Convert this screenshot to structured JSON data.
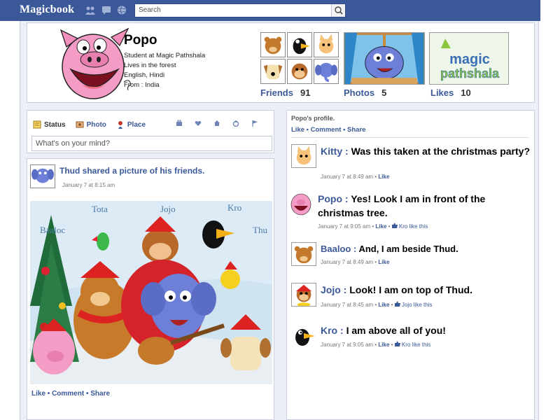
{
  "topbar": {
    "brand": "Magicbook",
    "search_placeholder": "Search"
  },
  "profile": {
    "name": "Popo",
    "info": [
      "Student at Magic Pathshala",
      "Lives in the forest",
      "English, Hindi",
      "From : India"
    ],
    "stats": {
      "friends_label": "Friends",
      "friends_count": "91",
      "photos_label": "Photos",
      "photos_count": "5",
      "likes_label": "Likes",
      "likes_count": "10"
    },
    "page_logo_line1": "magic",
    "page_logo_line2": "pathshala"
  },
  "composer": {
    "tab_status": "Status",
    "tab_photo": "Photo",
    "tab_place": "Place",
    "placeholder": "What's on your mind?"
  },
  "post": {
    "title": "Thud shared a picture of his friends.",
    "time": "January 7 at 8:15 am",
    "image_labels": [
      "Tota",
      "Jojo",
      "Kro",
      "Baaloc",
      "Thu"
    ],
    "actions": "Like • Comment • Share"
  },
  "feed": {
    "header": "Popo's profile.",
    "actions": "Like • Comment • Share",
    "comments": [
      {
        "name": "Kitty :",
        "text": "Was this taken at the christmas party?",
        "time": "January 7 at 8:49 am",
        "like": "Like",
        "extra": ""
      },
      {
        "name": "Popo :",
        "text": "Yes! Look I am in front  of the christmas tree.",
        "time": "January 7 at 9:05 am",
        "like": "Like",
        "extra": "Kro like this"
      },
      {
        "name": "Baaloo :",
        "text": "And, I am beside Thud.",
        "time": "January 7 at 8:49 am",
        "like": "Like",
        "extra": ""
      },
      {
        "name": "Jojo :",
        "text": "Look! I am on top of Thud.",
        "time": "January 7 at 8:45 am",
        "like": "Like",
        "extra": "Jojo like this"
      },
      {
        "name": "Kro :",
        "text": "I am above all of you!",
        "time": "January 7 at 9:05 am",
        "like": "Like",
        "extra": "Kro like this"
      }
    ]
  }
}
